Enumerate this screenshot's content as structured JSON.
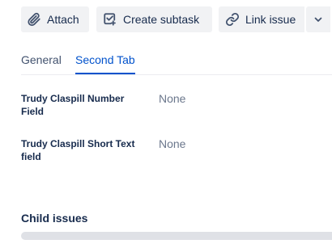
{
  "toolbar": {
    "attach_label": "Attach",
    "attach_icon": "paperclip-icon",
    "create_subtask_label": "Create subtask",
    "create_subtask_icon": "subtask-icon",
    "link_issue_label": "Link issue",
    "link_issue_icon": "link-icon",
    "more_icon": "chevron-down-icon"
  },
  "tabs": [
    {
      "label": "General",
      "active": false
    },
    {
      "label": "Second Tab",
      "active": true
    }
  ],
  "fields": [
    {
      "label": "Trudy Claspill Number Field",
      "value": "None"
    },
    {
      "label": "Trudy Claspill Short Text field",
      "value": "None"
    }
  ],
  "child_issues": {
    "title": "Child issues"
  },
  "colors": {
    "accent": "#0052cc",
    "button_bg": "#f1f2f4",
    "text": "#172b4d",
    "muted": "#6b778c"
  }
}
